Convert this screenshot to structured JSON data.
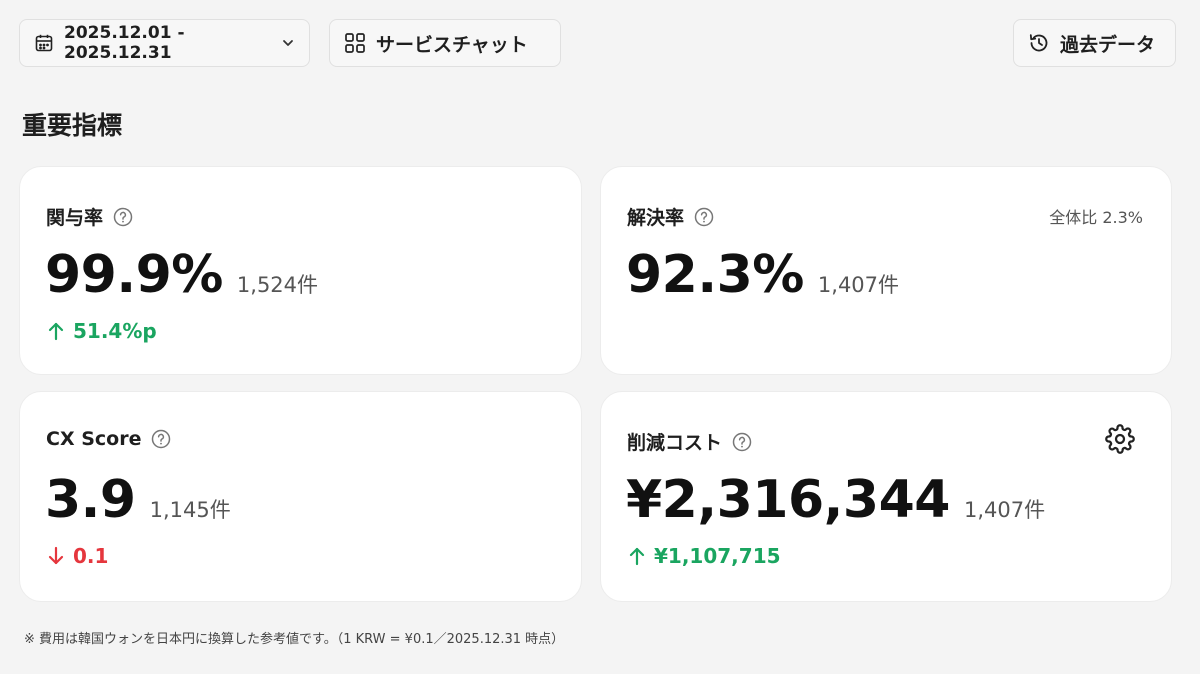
{
  "toolbar": {
    "date_range": "2025.12.01 - 2025.12.31",
    "service_label": "サービスチャット",
    "history_label": "過去データ"
  },
  "section": {
    "title": "重要指標"
  },
  "cards": {
    "engagement": {
      "label": "関与率",
      "value": "99.9%",
      "count": "1,524件",
      "delta": "51.4%p",
      "delta_direction": "up"
    },
    "resolution": {
      "label": "解決率",
      "value": "92.3%",
      "count": "1,407件",
      "meta": "全体比 2.3%"
    },
    "cx": {
      "label": "CX Score",
      "value": "3.9",
      "count": "1,145件",
      "delta": "0.1",
      "delta_direction": "down"
    },
    "cost": {
      "label": "削減コスト",
      "value": "¥2,316,344",
      "count": "1,407件",
      "delta": "¥1,107,715",
      "delta_direction": "up"
    }
  },
  "footnote": "※ 費用は韓国ウォンを日本円に換算した参考値です。（1 KRW = ¥0.1／2025.12.31 時点）",
  "colors": {
    "up": "#1aa560",
    "down": "#e5363d",
    "background": "#f4f4f4",
    "card": "#ffffff"
  },
  "icons": {
    "date": "calendar-icon",
    "date_dropdown": "chevron-down-icon",
    "service": "grid-icon",
    "history": "history-icon",
    "help": "question-circle-icon",
    "up": "arrow-up-icon",
    "down": "arrow-down-icon",
    "settings": "gear-icon"
  }
}
